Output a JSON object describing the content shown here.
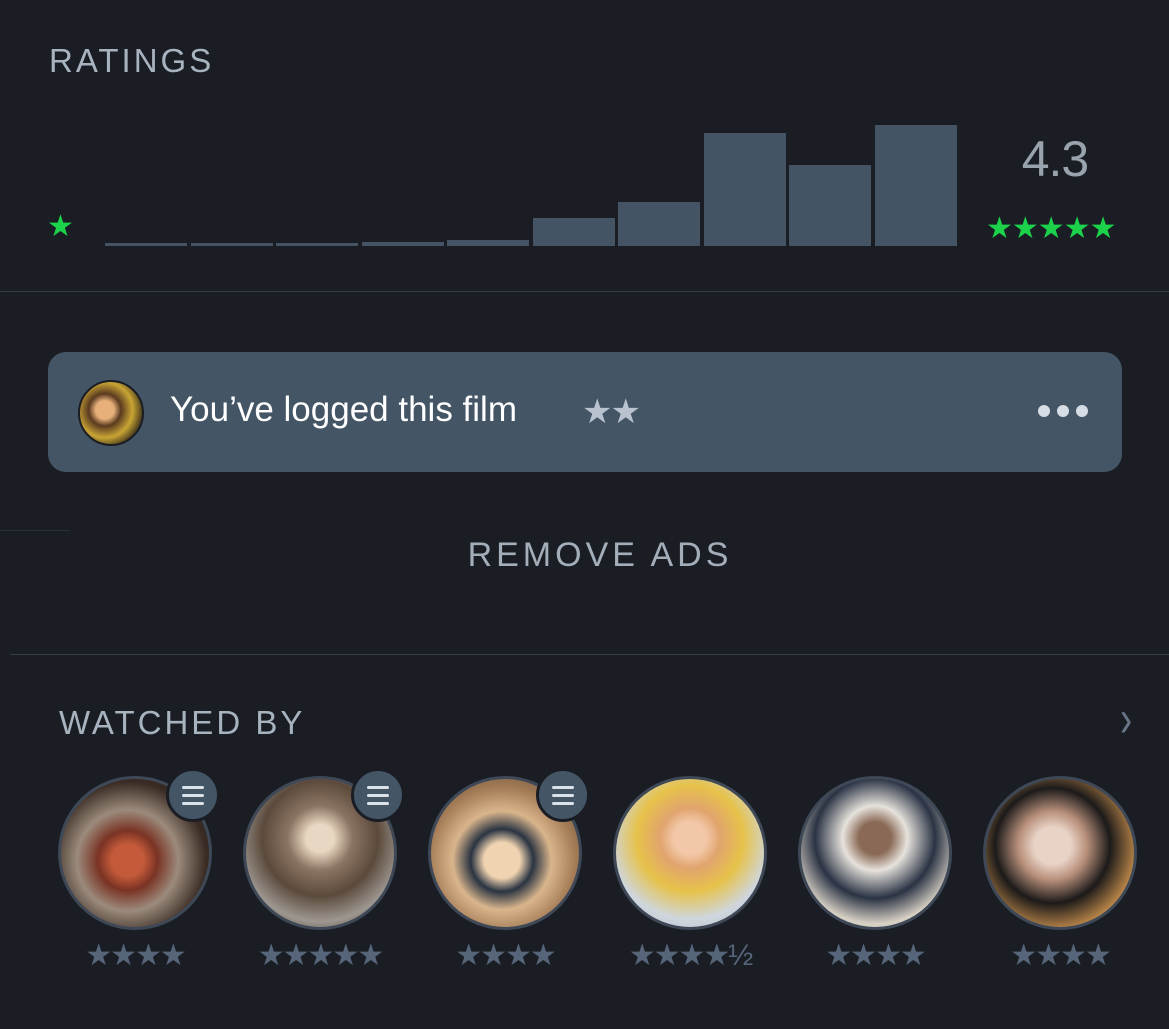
{
  "ratings": {
    "title": "RATINGS",
    "average": "4.3",
    "min_star": "★",
    "max_stars": "★★★★★",
    "histogram": [
      0.02,
      0.02,
      0.02,
      0.03,
      0.05,
      0.22,
      0.35,
      0.9,
      0.64,
      0.96
    ]
  },
  "log": {
    "text": "You’ve logged this film",
    "stars": "★★"
  },
  "remove_ads": "REMOVE ADS",
  "watched_by": {
    "title": "WATCHED BY",
    "chevron": "›",
    "members": [
      {
        "rating": "★★★★",
        "has_list": true
      },
      {
        "rating": "★★★★★",
        "has_list": true
      },
      {
        "rating": "★★★★",
        "has_list": true
      },
      {
        "rating": "★★★★½",
        "has_list": false
      },
      {
        "rating": "★★★★",
        "has_list": false
      },
      {
        "rating": "★★★★",
        "has_list": false
      }
    ]
  },
  "colors": {
    "background": "#1a1d23",
    "accent_green": "#1bd24a",
    "bar": "#455465",
    "card": "#445566"
  }
}
